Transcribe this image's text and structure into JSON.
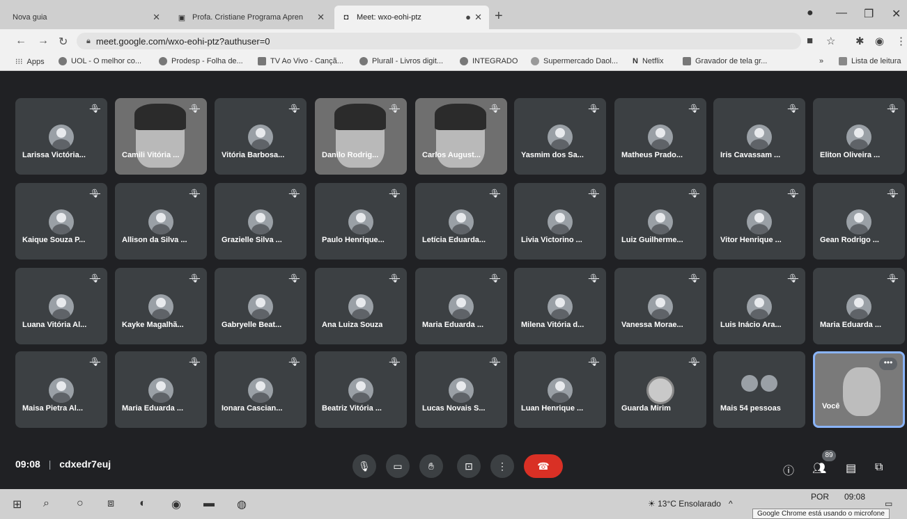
{
  "tabs": [
    {
      "label": "Nova guia",
      "active": false
    },
    {
      "label": "Profa. Cristiane Programa Apren",
      "active": false
    },
    {
      "label": "Meet: wxo-eohi-ptz",
      "active": true
    }
  ],
  "toolbar": {
    "url": "meet.google.com/wxo-eohi-ptz?authuser=0"
  },
  "bookmarks": [
    "Apps",
    "UOL - O melhor co...",
    "Prodesp - Folha de...",
    "TV Ao Vivo - Cançã...",
    "Plurall - Livros digit...",
    "INTEGRADO",
    "Supermercado Daol...",
    "Netflix",
    "Gravador de tela gr...",
    "Lista de leitura"
  ],
  "participants": [
    "Larissa Victória...",
    "Camili Vitória ...",
    "Vitória Barbosa...",
    "Danilo Rodrig...",
    "Carlos August...",
    "Yasmim dos Sa...",
    "Matheus Prado...",
    "Iris Cavassam ...",
    "Eliton Oliveira ...",
    "Kaique Souza P...",
    "Allison da Silva ...",
    "Grazielle Silva ...",
    "Paulo Henrique...",
    "Letícia Eduarda...",
    "Livia Victorino ...",
    "Luiz Guilherme...",
    "Vitor Henrique ...",
    "Gean Rodrigo ...",
    "Luana Vitória Al...",
    "Kayke Magalhã...",
    "Gabryelle Beat...",
    "Ana Luiza Souza",
    "Maria Eduarda ...",
    "Milena Vitória d...",
    "Vanessa Morae...",
    "Luis Inácio Ara...",
    "Maria Eduarda ...",
    "Maisa Pietra Al...",
    "Maria Eduarda ...",
    "Ionara Cascian...",
    "Beatriz Vitória ...",
    "Lucas Novais S...",
    "Luan Henrique ...",
    "Guarda Mirim",
    "Mais 54 pessoas",
    "Você"
  ],
  "meeting": {
    "time": "09:08",
    "code": "cdxedr7euj",
    "people_count": "89"
  },
  "taskbar": {
    "weather": "13°C Ensolarado",
    "lang": "POR",
    "clock": "09:08",
    "tooltip": "Google Chrome está usando o microfone"
  }
}
